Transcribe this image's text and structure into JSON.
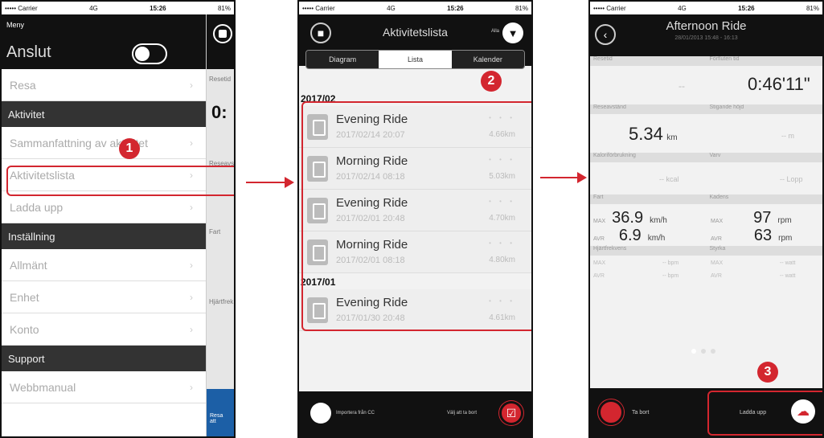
{
  "status": {
    "carrier": "••••• Carrier",
    "net": "4G",
    "time": "15:26",
    "battery": "81%"
  },
  "screen1": {
    "menu_title": "Meny",
    "connect_label": "Anslut",
    "items": [
      {
        "type": "item",
        "label": "Resa"
      },
      {
        "type": "section",
        "label": "Aktivitet"
      },
      {
        "type": "item",
        "label": "Sammanfattning av aktivitet"
      },
      {
        "type": "item",
        "label": "Aktivitetslista"
      },
      {
        "type": "item",
        "label": "Ladda upp"
      },
      {
        "type": "section",
        "label": "Inställning"
      },
      {
        "type": "item",
        "label": "Allmänt"
      },
      {
        "type": "item",
        "label": "Enhet"
      },
      {
        "type": "item",
        "label": "Konto"
      },
      {
        "type": "section",
        "label": "Support"
      },
      {
        "type": "item",
        "label": "Webbmanual"
      }
    ],
    "bg_labels": {
      "restid": "Resetid",
      "value": "0:",
      "reseavst": "Reseavst",
      "fart": "Fart",
      "hjarthet": "Hjärtfrek",
      "blue": "Resa att"
    }
  },
  "screen2": {
    "title": "Aktivitetslista",
    "filter_label": "Alla",
    "tabs": [
      "Diagram",
      "Lista",
      "Kalender"
    ],
    "groups": [
      {
        "month": "2017/02",
        "rides": [
          {
            "name": "Evening Ride",
            "date": "2017/02/14 20:07",
            "dist": "4.66km"
          },
          {
            "name": "Morning Ride",
            "date": "2017/02/14 08:18",
            "dist": "5.03km"
          },
          {
            "name": "Evening Ride",
            "date": "2017/02/01 20:48",
            "dist": "4.70km"
          },
          {
            "name": "Morning Ride",
            "date": "2017/02/01 08:18",
            "dist": "4.80km"
          }
        ]
      },
      {
        "month": "2017/01",
        "rides": [
          {
            "name": "Evening Ride",
            "date": "2017/01/30 20:48",
            "dist": "4.61km"
          }
        ]
      }
    ],
    "footer_left": "Importera från CC",
    "footer_right": "Välj att ta bort"
  },
  "screen3": {
    "title": "Afternoon Ride",
    "subtitle": "28/01/2013 15:48 - 16:13",
    "restid_label": "Resetid",
    "restid_value": "--",
    "fortid_label": "Förfluten tid",
    "fortid_value": "0:46'11\"",
    "reseavst_label": "Reseavstånd",
    "reseavst_value": "5.34",
    "reseavst_unit": "km",
    "stig_label": "Stigande höjd",
    "stig_value": "-- m",
    "kal_label": "Kaloriförbrukning",
    "kal_value": "-- kcal",
    "varv_label": "Varv",
    "varv_value": "-- Lopp",
    "fart_label": "Fart",
    "kadens_label": "Kadens",
    "max": "MAX",
    "avr": "AVR",
    "fart_max": "36.9",
    "fart_avr": "6.9",
    "fart_unit": "km/h",
    "kad_max": "97",
    "kad_avr": "63",
    "kad_unit": "rpm",
    "hjart_label": "Hjärtfrekvens",
    "styrka_label": "Styrka",
    "hjart_max": "-- bpm",
    "hjart_avr": "-- bpm",
    "sty_max": "-- watt",
    "sty_avr": "-- watt",
    "delete_label": "Ta bort",
    "upload_label": "Ladda upp"
  },
  "markers": [
    "1",
    "2",
    "3"
  ],
  "colors": {
    "accent": "#d3262f"
  }
}
